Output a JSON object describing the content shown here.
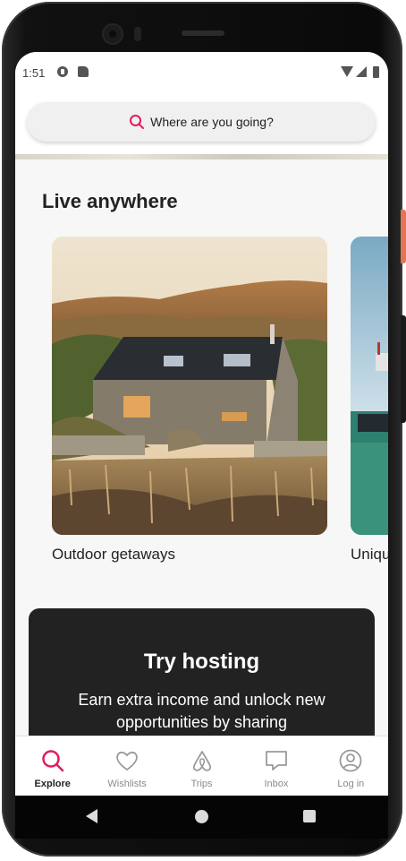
{
  "status_bar": {
    "time": "1:51"
  },
  "search": {
    "placeholder": "Where are you going?"
  },
  "section": {
    "title": "Live anywhere"
  },
  "cards": [
    {
      "label": "Outdoor getaways"
    },
    {
      "label": "Unique stays"
    }
  ],
  "hosting": {
    "title": "Try hosting",
    "body": "Earn extra income and unlock new opportunities by sharing"
  },
  "tabs": [
    {
      "label": "Explore",
      "icon": "search-icon",
      "active": true
    },
    {
      "label": "Wishlists",
      "icon": "heart-icon",
      "active": false
    },
    {
      "label": "Trips",
      "icon": "airbnb-logo-icon",
      "active": false
    },
    {
      "label": "Inbox",
      "icon": "message-icon",
      "active": false
    },
    {
      "label": "Log in",
      "icon": "profile-icon",
      "active": false
    }
  ],
  "colors": {
    "accent": "#E31C5F",
    "dark_card": "#222222",
    "text": "#222222",
    "inactive": "#8A8A8A"
  }
}
